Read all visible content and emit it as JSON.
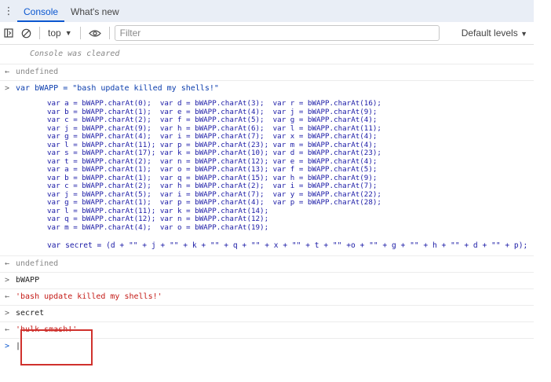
{
  "tabs": [
    {
      "label": "Console",
      "active": true
    },
    {
      "label": "What's new",
      "active": false
    }
  ],
  "toolbar": {
    "context": "top",
    "filter_placeholder": "Filter",
    "levels_label": "Default levels"
  },
  "console": {
    "cleared": "Console was cleared",
    "undefined1": "undefined",
    "cmd1": "var bWAPP = \"bash update killed my shells!\"",
    "code_lines": [
      "var a = bWAPP.charAt(0);  var d = bWAPP.charAt(3);  var r = bWAPP.charAt(16);",
      "var b = bWAPP.charAt(1);  var e = bWAPP.charAt(4);  var j = bWAPP.charAt(9);",
      "var c = bWAPP.charAt(2);  var f = bWAPP.charAt(5);  var g = bWAPP.charAt(4);",
      "var j = bWAPP.charAt(9);  var h = bWAPP.charAt(6);  var l = bWAPP.charAt(11);",
      "var g = bWAPP.charAt(4);  var i = bWAPP.charAt(7);  var x = bWAPP.charAt(4);",
      "var l = bWAPP.charAt(11); var p = bWAPP.charAt(23); var m = bWAPP.charAt(4);",
      "var s = bWAPP.charAt(17); var k = bWAPP.charAt(10); var d = bWAPP.charAt(23);",
      "var t = bWAPP.charAt(2);  var n = bWAPP.charAt(12); var e = bWAPP.charAt(4);",
      "var a = bWAPP.charAt(1);  var o = bWAPP.charAt(13); var f = bWAPP.charAt(5);",
      "var b = bWAPP.charAt(1);  var q = bWAPP.charAt(15); var h = bWAPP.charAt(9);",
      "var c = bWAPP.charAt(2);  var h = bWAPP.charAt(2);  var i = bWAPP.charAt(7);",
      "var j = bWAPP.charAt(5);  var i = bWAPP.charAt(7);  var y = bWAPP.charAt(22);",
      "var g = bWAPP.charAt(1);  var p = bWAPP.charAt(4);  var p = bWAPP.charAt(28);",
      "var l = bWAPP.charAt(11); var k = bWAPP.charAt(14);",
      "var q = bWAPP.charAt(12); var n = bWAPP.charAt(12);",
      "var m = bWAPP.charAt(4);  var o = bWAPP.charAt(19);"
    ],
    "secret_line": "var secret = (d + \"\" + j + \"\" + k + \"\" + q + \"\" + x + \"\" + t + \"\" +o + \"\" + g + \"\" + h + \"\" + d + \"\" + p);",
    "undefined2": "undefined",
    "cmd2": "bWAPP",
    "result2": "'bash update killed my shells!'",
    "cmd3": "secret",
    "result3": "'hulk smash!'",
    "prompt": "|"
  }
}
